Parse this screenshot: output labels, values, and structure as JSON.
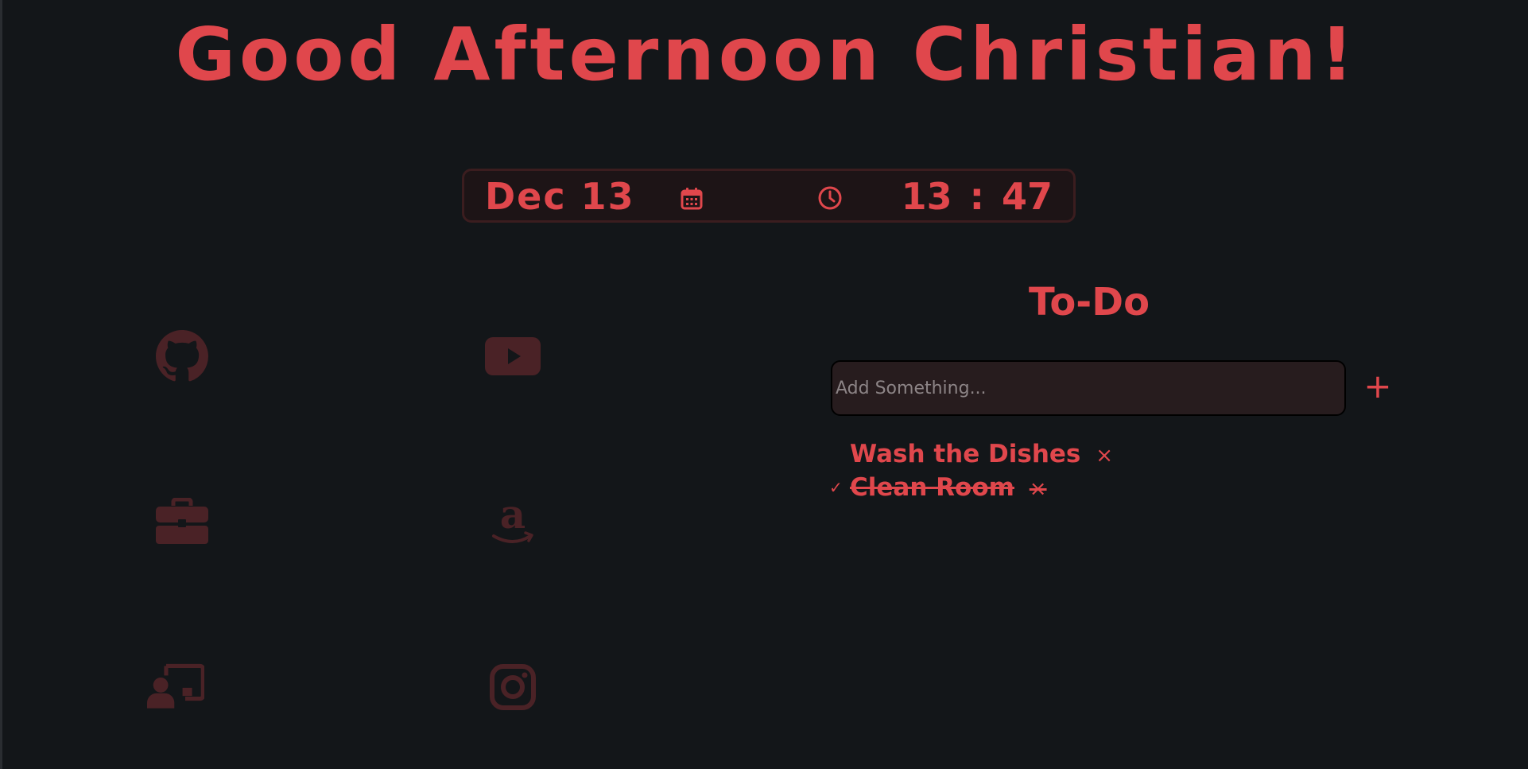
{
  "greeting": "Good Afternoon Christian!",
  "clock": {
    "date": "Dec 13",
    "hours": "13",
    "separator": ":",
    "minutes": "47"
  },
  "links": [
    {
      "name": "github-icon"
    },
    {
      "name": "youtube-icon"
    },
    {
      "name": "briefcase-icon"
    },
    {
      "name": "amazon-icon"
    },
    {
      "name": "chalkboard-user-icon"
    },
    {
      "name": "instagram-icon"
    }
  ],
  "todo": {
    "title": "To-Do",
    "input_placeholder": "Add Something...",
    "add_label": "+",
    "remove_label": "×",
    "check_label": "✓",
    "items": [
      {
        "text": "Wash the Dishes",
        "done": false
      },
      {
        "text": "Clean Room",
        "done": true
      }
    ]
  },
  "colors": {
    "accent": "#e0474c",
    "icon_muted": "#4a2226",
    "background": "#131619",
    "input_bg": "#271c1e"
  }
}
